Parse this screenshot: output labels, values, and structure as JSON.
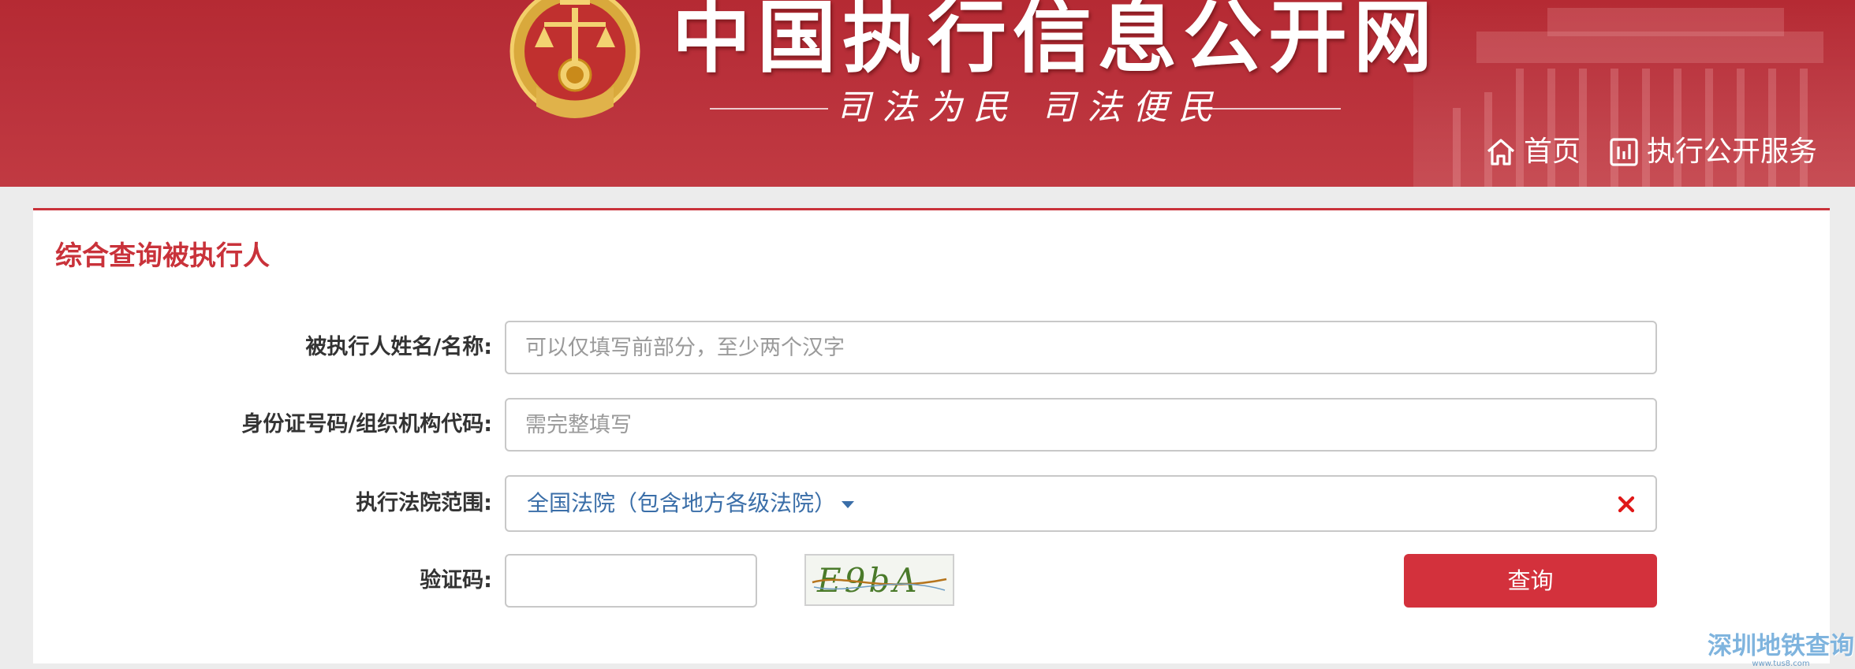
{
  "header": {
    "site_title": "中国执行信息公开网",
    "slogan": "司法为民  司法便民",
    "nav": [
      {
        "label": "首页",
        "icon": "home-icon"
      },
      {
        "label": "执行公开服务",
        "icon": "bar-chart-icon"
      }
    ]
  },
  "panel": {
    "title": "综合查询被执行人",
    "fields": {
      "name_label": "被执行人姓名/名称:",
      "name_placeholder": "可以仅填写前部分，至少两个汉字",
      "id_label": "身份证号码/组织机构代码:",
      "id_placeholder": "需完整填写",
      "court_label": "执行法院范围:",
      "court_value": "全国法院（包含地方各级法院）",
      "captcha_label": "验证码:",
      "captcha_value": "",
      "captcha_image_text": "E9bA"
    },
    "search_button": "查询"
  },
  "watermark": {
    "main": "深圳地铁查询",
    "url": "www.tus8.com"
  },
  "colors": {
    "brand_red": "#c9323a",
    "button_red": "#d3313c",
    "select_blue": "#3a6ea8"
  }
}
